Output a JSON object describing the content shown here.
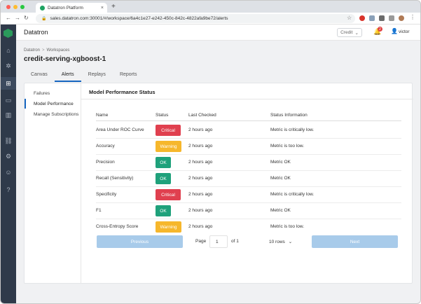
{
  "browser": {
    "tab_title": "Datatron Platform",
    "tab_close": "×",
    "new_tab": "+",
    "url": "sales.datatron.com:30001/#/workspace/6a4c1e27-e242-450c-842c-4822afa9be72/alerts",
    "back": "←",
    "forward": "→",
    "reload": "↻",
    "star": "☆"
  },
  "colors": {
    "accent": "#1565c0",
    "critical": "#e0404f",
    "warning": "#f6b72c",
    "ok": "#1fa17b",
    "rail": "#2f3a4a",
    "button_disabled": "#a8cbea"
  },
  "header": {
    "brand": "Datatron",
    "credit_label": "Credit",
    "credit_chevron": "⌄",
    "notification_count": "2",
    "bell_icon": "bell-icon",
    "user_name": "victor"
  },
  "breadcrumb": {
    "root": "Datatron",
    "sep": ">",
    "current": "Workspaces"
  },
  "page_title": "credit-serving-xgboost-1",
  "tabs": [
    {
      "label": "Canvas"
    },
    {
      "label": "Alerts"
    },
    {
      "label": "Replays"
    },
    {
      "label": "Reports"
    }
  ],
  "subnav": [
    {
      "label": "Failures"
    },
    {
      "label": "Model Performance"
    },
    {
      "label": "Manage Subscriptions"
    }
  ],
  "content_title": "Model Performance Status",
  "table": {
    "columns": [
      "Name",
      "Status",
      "Last Checked",
      "Status Information"
    ],
    "rows": [
      {
        "name": "Area Under ROC Curve",
        "status": "Critical",
        "last_checked": "2 hours ago",
        "info": "Metric is critically low."
      },
      {
        "name": "Accuracy",
        "status": "Warning",
        "last_checked": "2 hours ago",
        "info": "Metric is too low."
      },
      {
        "name": "Precision",
        "status": "OK",
        "last_checked": "2 hours ago",
        "info": "Metric OK"
      },
      {
        "name": "Recall (Sensitivity)",
        "status": "OK",
        "last_checked": "2 hours ago",
        "info": "Metric OK"
      },
      {
        "name": "Specificity",
        "status": "Critical",
        "last_checked": "2 hours ago",
        "info": "Metric is critically low."
      },
      {
        "name": "F1",
        "status": "OK",
        "last_checked": "2 hours ago",
        "info": "Metric OK"
      },
      {
        "name": "Cross-Entropy Score",
        "status": "Warning",
        "last_checked": "2 hours ago",
        "info": "Metric is too low."
      }
    ]
  },
  "pagination": {
    "previous": "Previous",
    "next": "Next",
    "page_label": "Page",
    "page_value": "1",
    "of_label": "of 1",
    "rows_label": "10 rows",
    "rows_chevron": "⌄"
  }
}
